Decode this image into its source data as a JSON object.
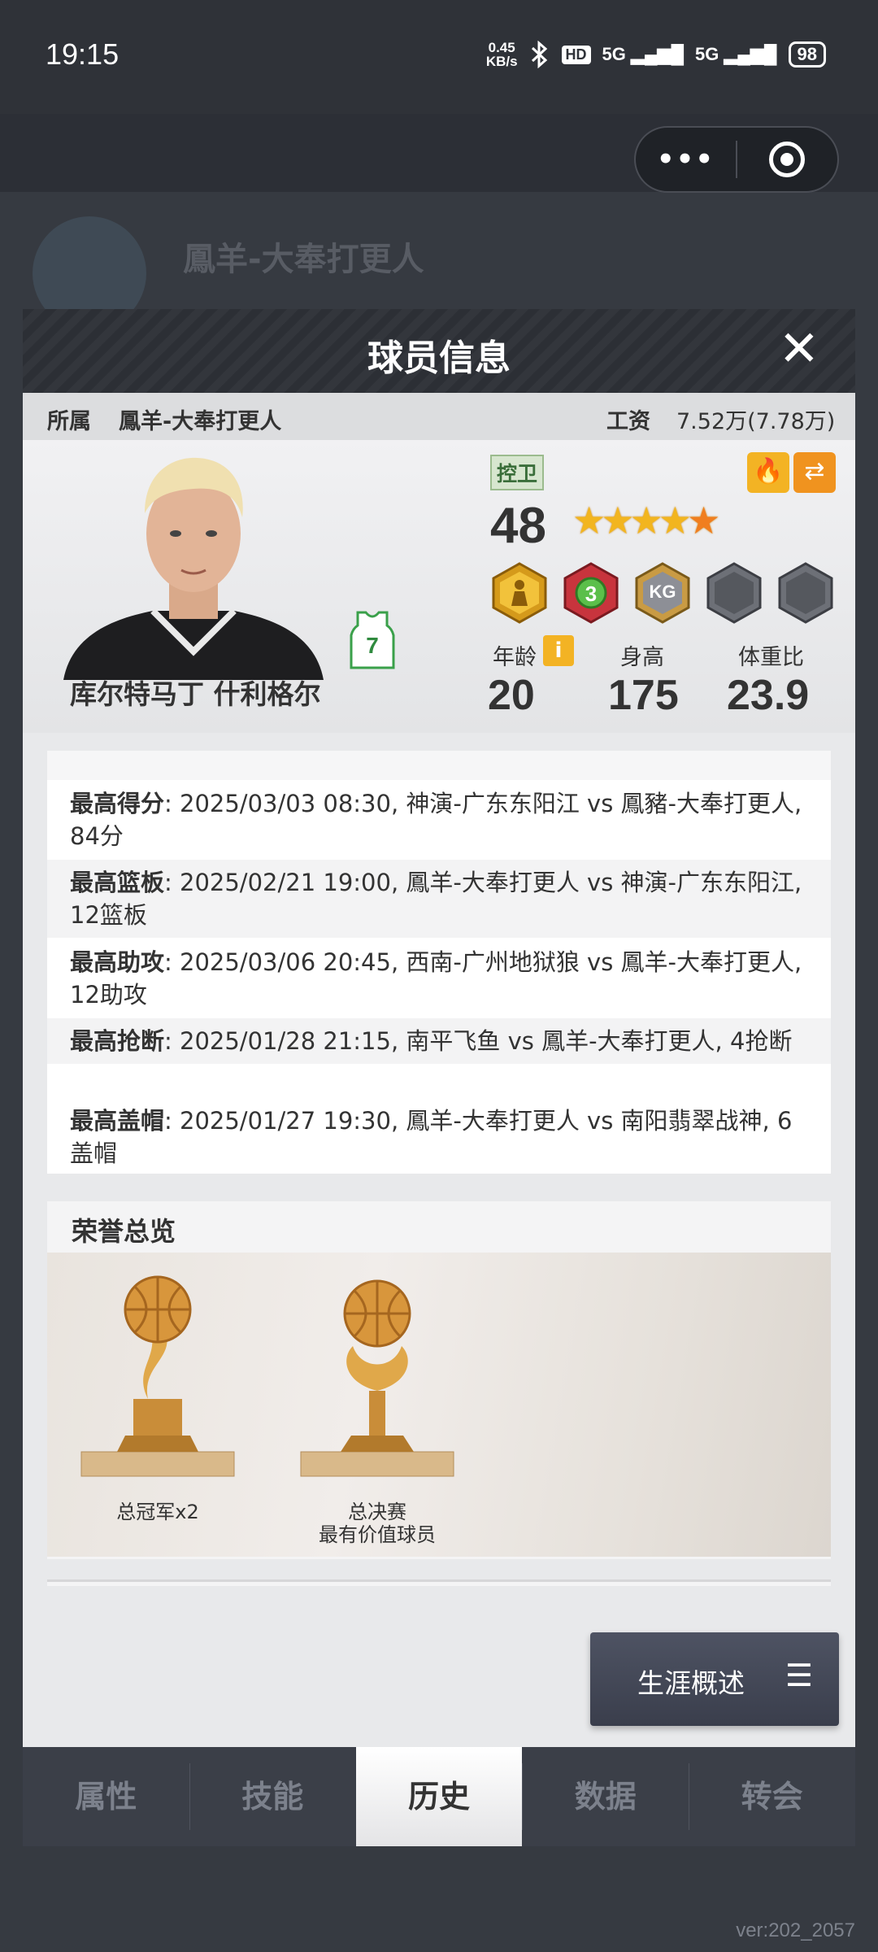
{
  "status_bar": {
    "time": "19:15",
    "net_speed_value": "0.45",
    "net_speed_unit": "KB/s",
    "hd_label": "HD",
    "signal1": "5G",
    "signal2": "5G",
    "battery": "98"
  },
  "capsule": {
    "more": "•••"
  },
  "background": {
    "team_title": "鳳羊-大奉打更人"
  },
  "modal": {
    "title": "球员信息",
    "close": "✕",
    "team_label": "所属",
    "team_value": "鳳羊-大奉打更人",
    "salary_label": "工资",
    "salary_value": "7.52万(7.78万)"
  },
  "player": {
    "name": "库尔特马丁 什利格尔",
    "jersey_number": "7",
    "position": "控卫",
    "overall": "48",
    "star_rating": 4.5,
    "age_label": "年龄",
    "age": "20",
    "height_label": "身高",
    "height": "175",
    "weight_ratio_label": "体重比",
    "weight_ratio": "23.9",
    "badges": [
      "athlete-badge",
      "level-3-badge",
      "kg-badge",
      "locked-badge",
      "locked-badge"
    ]
  },
  "records": [
    {
      "label": "最高得分",
      "text": ": 2025/03/03 08:30, 神演-广东东阳江 vs 鳳豬-大奉打更人, 84分"
    },
    {
      "label": "最高篮板",
      "text": ": 2025/02/21 19:00, 鳳羊-大奉打更人 vs 神演-广东东阳江, 12篮板"
    },
    {
      "label": "最高助攻",
      "text": ": 2025/03/06 20:45, 西南-广州地狱狼 vs 鳳羊-大奉打更人, 12助攻"
    },
    {
      "label": "最高抢断",
      "text": ": 2025/01/28 21:15, 南平飞鱼 vs 鳳羊-大奉打更人, 4抢断"
    },
    {
      "label": "最高盖帽",
      "text": ": 2025/01/27 19:30, 鳳羊-大奉打更人 vs 南阳翡翠战神, 6盖帽"
    }
  ],
  "honors": {
    "title": "荣誉总览",
    "items": [
      {
        "caption": "总冠军x2"
      },
      {
        "caption_line1": "总决赛",
        "caption_line2": "最有价值球员"
      }
    ]
  },
  "career_button": {
    "label": "生涯概述",
    "menu_icon": "☰"
  },
  "tabs": [
    {
      "label": "属性",
      "active": false
    },
    {
      "label": "技能",
      "active": false
    },
    {
      "label": "历史",
      "active": true
    },
    {
      "label": "数据",
      "active": false
    },
    {
      "label": "转会",
      "active": false
    }
  ],
  "version": "ver:202_2057",
  "colors": {
    "accent_gold": "#f3b324",
    "accent_orange": "#f0931f",
    "header_dark": "#2c2f35",
    "tab_bar": "#3b3f48"
  }
}
